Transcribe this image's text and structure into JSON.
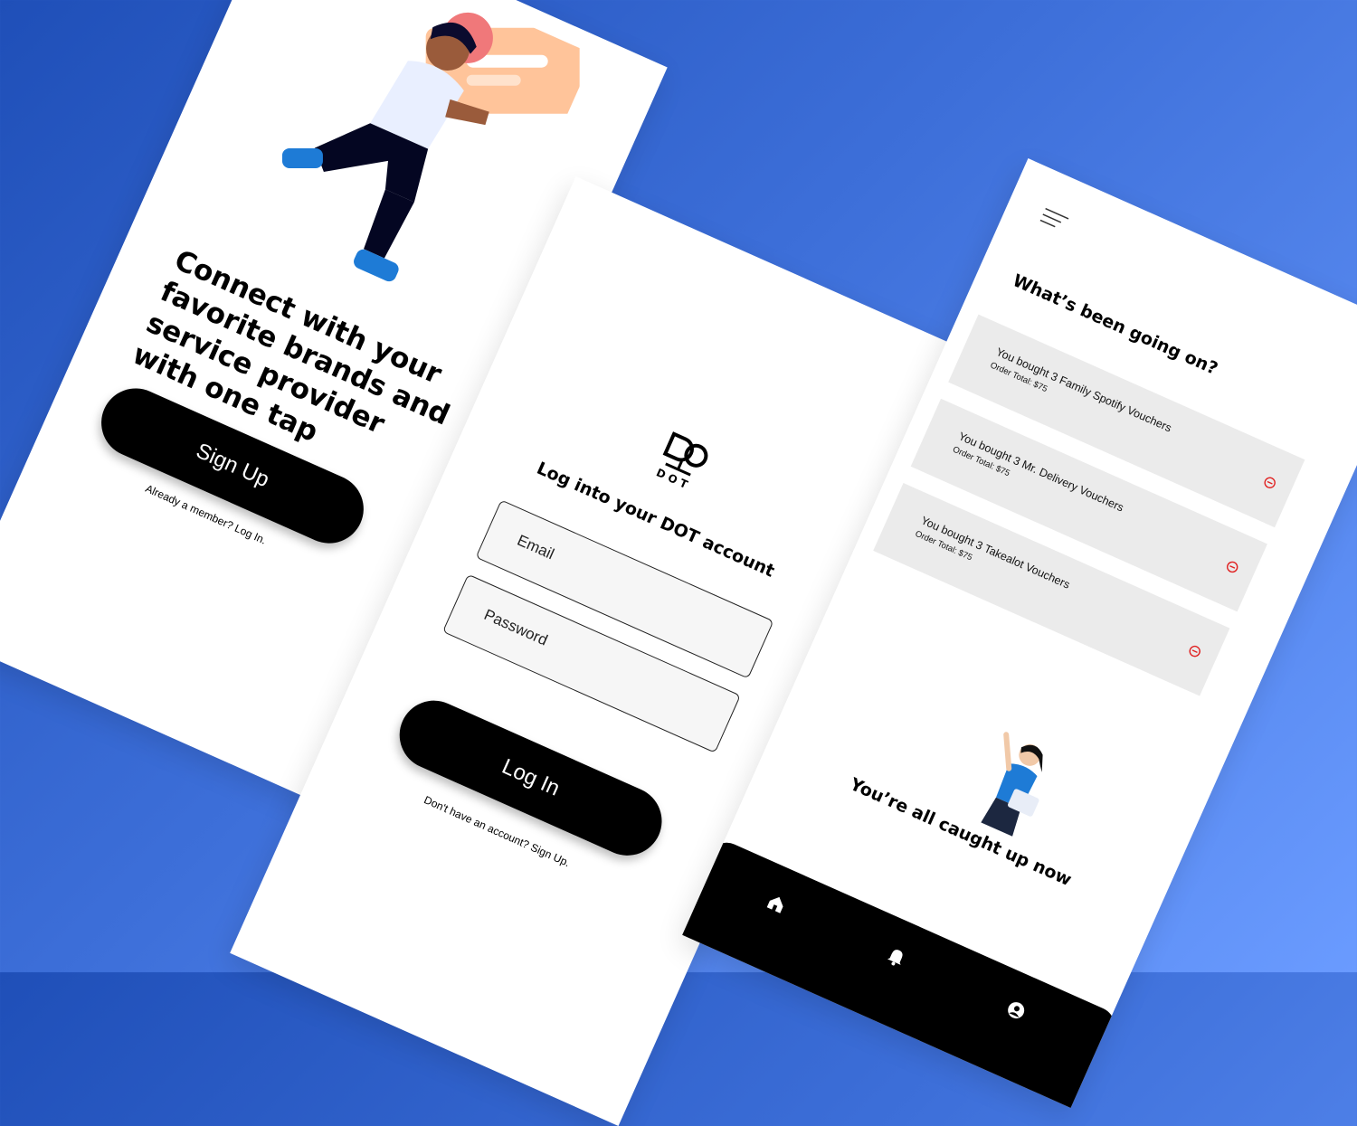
{
  "screens": {
    "welcome": {
      "headline": "Connect with your favorite brands and service provider with one tap",
      "signup_label": "Sign Up",
      "member_text": "Already a member? Log In."
    },
    "login": {
      "logo_text": "DOT",
      "title": "Log into your DOT account",
      "email_placeholder": "Email",
      "password_placeholder": "Password",
      "login_label": "Log In",
      "signup_text": "Don't have an account? Sign Up."
    },
    "activity": {
      "title": "What’s been going on?",
      "items": [
        {
          "title": "You bought 3 Family Spotify Vouchers",
          "subtitle": "Order Total: $75"
        },
        {
          "title": "You bought 3 Mr. Delivery Vouchers",
          "subtitle": "Order Total: $75"
        },
        {
          "title": "You bought 3 Takealot Vouchers",
          "subtitle": "Order Total: $75"
        }
      ],
      "empty_text": "You’re all caught up now",
      "tabs": [
        "home-icon",
        "bell-icon",
        "profile-icon"
      ]
    }
  },
  "colors": {
    "background_start": "#1f4fb8",
    "background_end": "#6a9bff",
    "button": "#000000",
    "card": "#ebebeb",
    "remove_icon": "#e02020",
    "illustration_card": "#ffc49a",
    "shirt_blue": "#1e7bd6"
  }
}
